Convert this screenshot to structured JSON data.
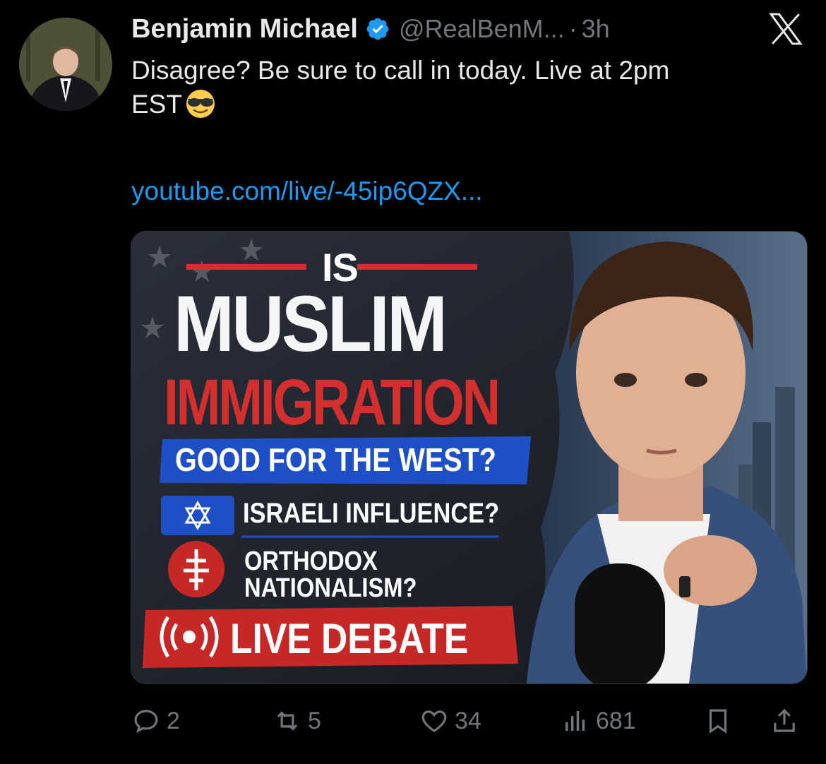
{
  "tweet": {
    "author_name": "Benjamin Michael",
    "handle": "@RealBenM...",
    "separator": "·",
    "time": "3h",
    "text_line1": "Disagree? Be sure to call in today. Live at 2pm",
    "text_line2": "EST",
    "emoji": "smiling-face-with-sunglasses",
    "link": "youtube.com/live/-45ip6QZX..."
  },
  "media": {
    "is": "IS",
    "muslim": "MUSLIM",
    "immigration": "IMMIGRATION",
    "good": "GOOD FOR THE WEST?",
    "israeli": "ISRAELI INFLUENCE?",
    "orthodox": "ORTHODOX",
    "nationalism": "NATIONALISM?",
    "live": "LIVE DEBATE"
  },
  "actions": {
    "replies": "2",
    "reposts": "5",
    "likes": "34",
    "views": "681"
  },
  "colors": {
    "background": "#000000",
    "text": "#e7e9ea",
    "muted": "#71767b",
    "link": "#1d9bf0",
    "verified": "#1d9bf0",
    "accent_red": "#d32f2f",
    "accent_blue": "#1e4fc4"
  }
}
